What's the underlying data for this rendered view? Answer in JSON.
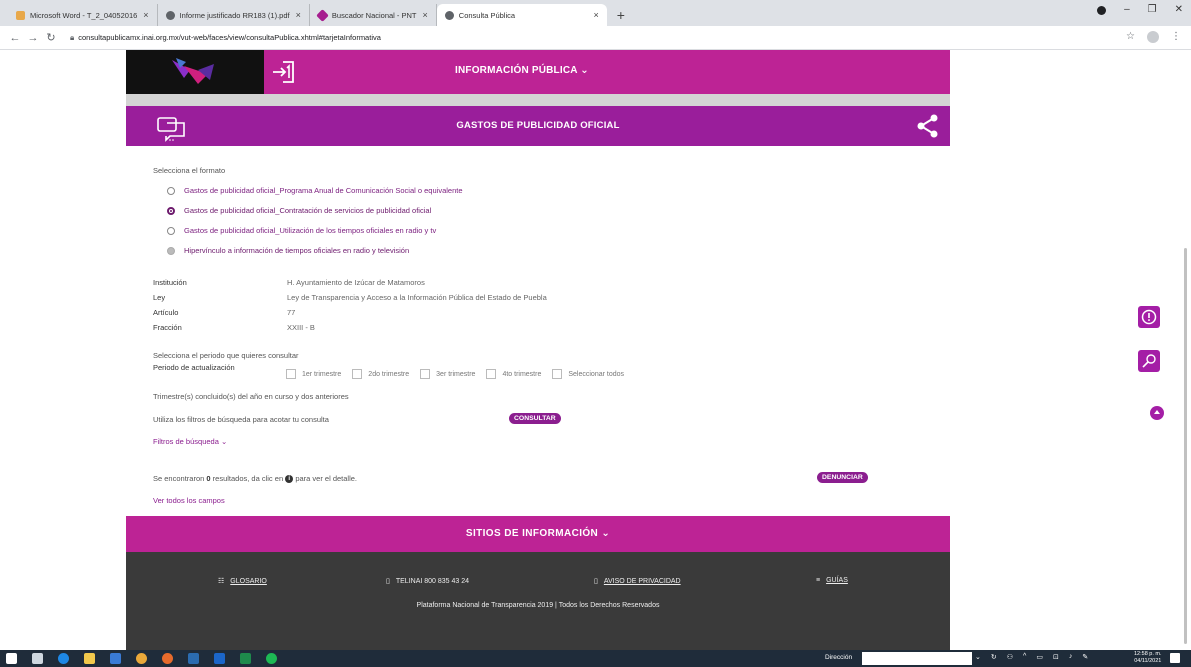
{
  "browser": {
    "tabs": [
      {
        "label": "Microsoft Word - T_2_04052016",
        "color": "#e8a84a"
      },
      {
        "label": "Informe justificado RR183 (1).pdf",
        "color": "#5f6368"
      },
      {
        "label": "Buscador Nacional - PNT",
        "color": "#a61e8f"
      },
      {
        "label": "Consulta Pública",
        "color": "#5f6368"
      }
    ],
    "new_tab": "+",
    "url": "consultapublicamx.inai.org.mx/vut-web/faces/view/consultaPublica.xhtml#tarjetaInformativa"
  },
  "header": {
    "info_publica": "INFORMACIÓN PÚBLICA ⌄"
  },
  "section": {
    "title": "GASTOS DE PUBLICIDAD OFICIAL"
  },
  "format": {
    "label": "Selecciona el formato",
    "options": [
      {
        "text": "Gastos de publicidad oficial_Programa Anual de Comunicación Social o equivalente",
        "state": "off"
      },
      {
        "text": "Gastos de publicidad oficial_Contratación de servicios de publicidad oficial",
        "state": "on"
      },
      {
        "text": "Gastos de publicidad oficial_Utilización de los tiempos oficiales en radio y tv",
        "state": "off"
      },
      {
        "text": "Hipervínculo a información de tiempos oficiales en radio y televisión",
        "state": "disabled"
      }
    ]
  },
  "details": [
    {
      "key": "Institución",
      "value": "H. Ayuntamiento de Izúcar de Matamoros"
    },
    {
      "key": "Ley",
      "value": "Ley de Transparencia y Acceso a la Información Pública del Estado de Puebla"
    },
    {
      "key": "Artículo",
      "value": "77"
    },
    {
      "key": "Fracción",
      "value": "XXIII - B"
    }
  ],
  "periodo": {
    "label": "Selecciona el periodo que quieres consultar",
    "update_label": "Periodo de actualización",
    "checks": [
      "1er trimestre",
      "2do trimestre",
      "3er trimestre",
      "4to trimestre",
      "Seleccionar todos"
    ],
    "note": "Trimestre(s) concluido(s) del año en curso y dos anteriores"
  },
  "filters": {
    "hint": "Utiliza los filtros de búsqueda para acotar tu consulta",
    "consultar": "CONSULTAR",
    "filtros_link": "Filtros de búsqueda ⌄"
  },
  "results": {
    "prefix": "Se encontraron",
    "count": "0",
    "suffix_a": "resultados, da clic en",
    "suffix_b": "para ver el detalle.",
    "denunciar": "DENUNCIAR",
    "ver_todos": "Ver todos los campos"
  },
  "sitios": "SITIOS DE INFORMACIÓN ⌄",
  "footer": {
    "glosario": "GLOSARIO",
    "telinai": "TELINAI 800 835 43 24",
    "aviso": "AVISO DE PRIVACIDAD",
    "guias": "GUÍAS",
    "copyright": "Plataforma Nacional de Transparencia 2019 | Todos los Derechos Reservados"
  },
  "taskbar": {
    "direccion": "Dirección",
    "time": "12:58 p. m.",
    "date": "04/11/2021"
  },
  "colors": {
    "magenta": "#bd2395",
    "purple": "#9a1e9b",
    "footer_dark": "#3a3a3a"
  }
}
